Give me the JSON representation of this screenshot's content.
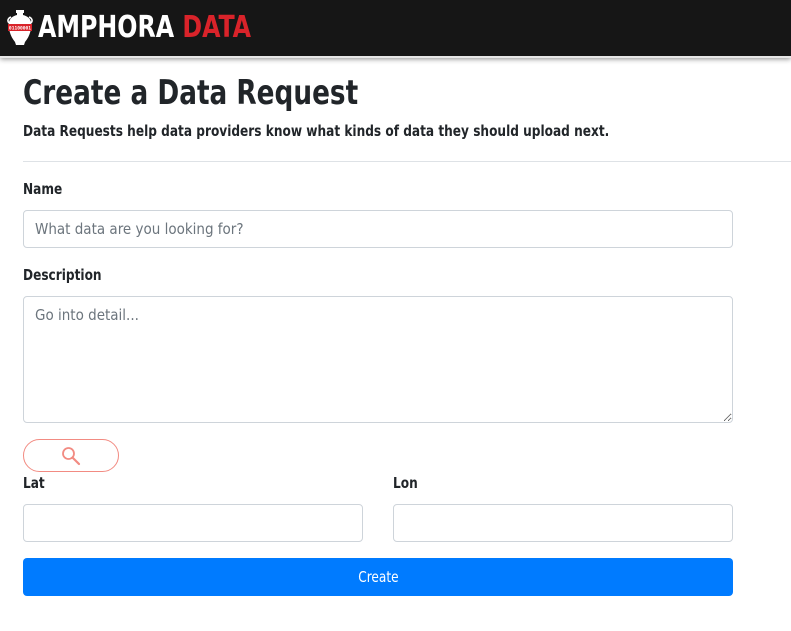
{
  "brand": {
    "logo_label": "01100001",
    "name_part1": "AMPHORA",
    "name_part2": "DATA",
    "colors": {
      "navbar_bg": "#161616",
      "text_light": "#ffffff",
      "accent_red": "#d9232a"
    }
  },
  "page": {
    "title": "Create a Data Request",
    "subtitle": "Data Requests help data providers know what kinds of data they should upload next."
  },
  "form": {
    "name": {
      "label": "Name",
      "placeholder": "What data are you looking for?",
      "value": ""
    },
    "description": {
      "label": "Description",
      "placeholder": "Go into detail...",
      "value": ""
    },
    "search_button": {
      "icon": "search-icon",
      "color": "#f28b82"
    },
    "lat": {
      "label": "Lat",
      "value": ""
    },
    "lon": {
      "label": "Lon",
      "value": ""
    },
    "submit": {
      "label": "Create",
      "color": "#007bff"
    }
  }
}
